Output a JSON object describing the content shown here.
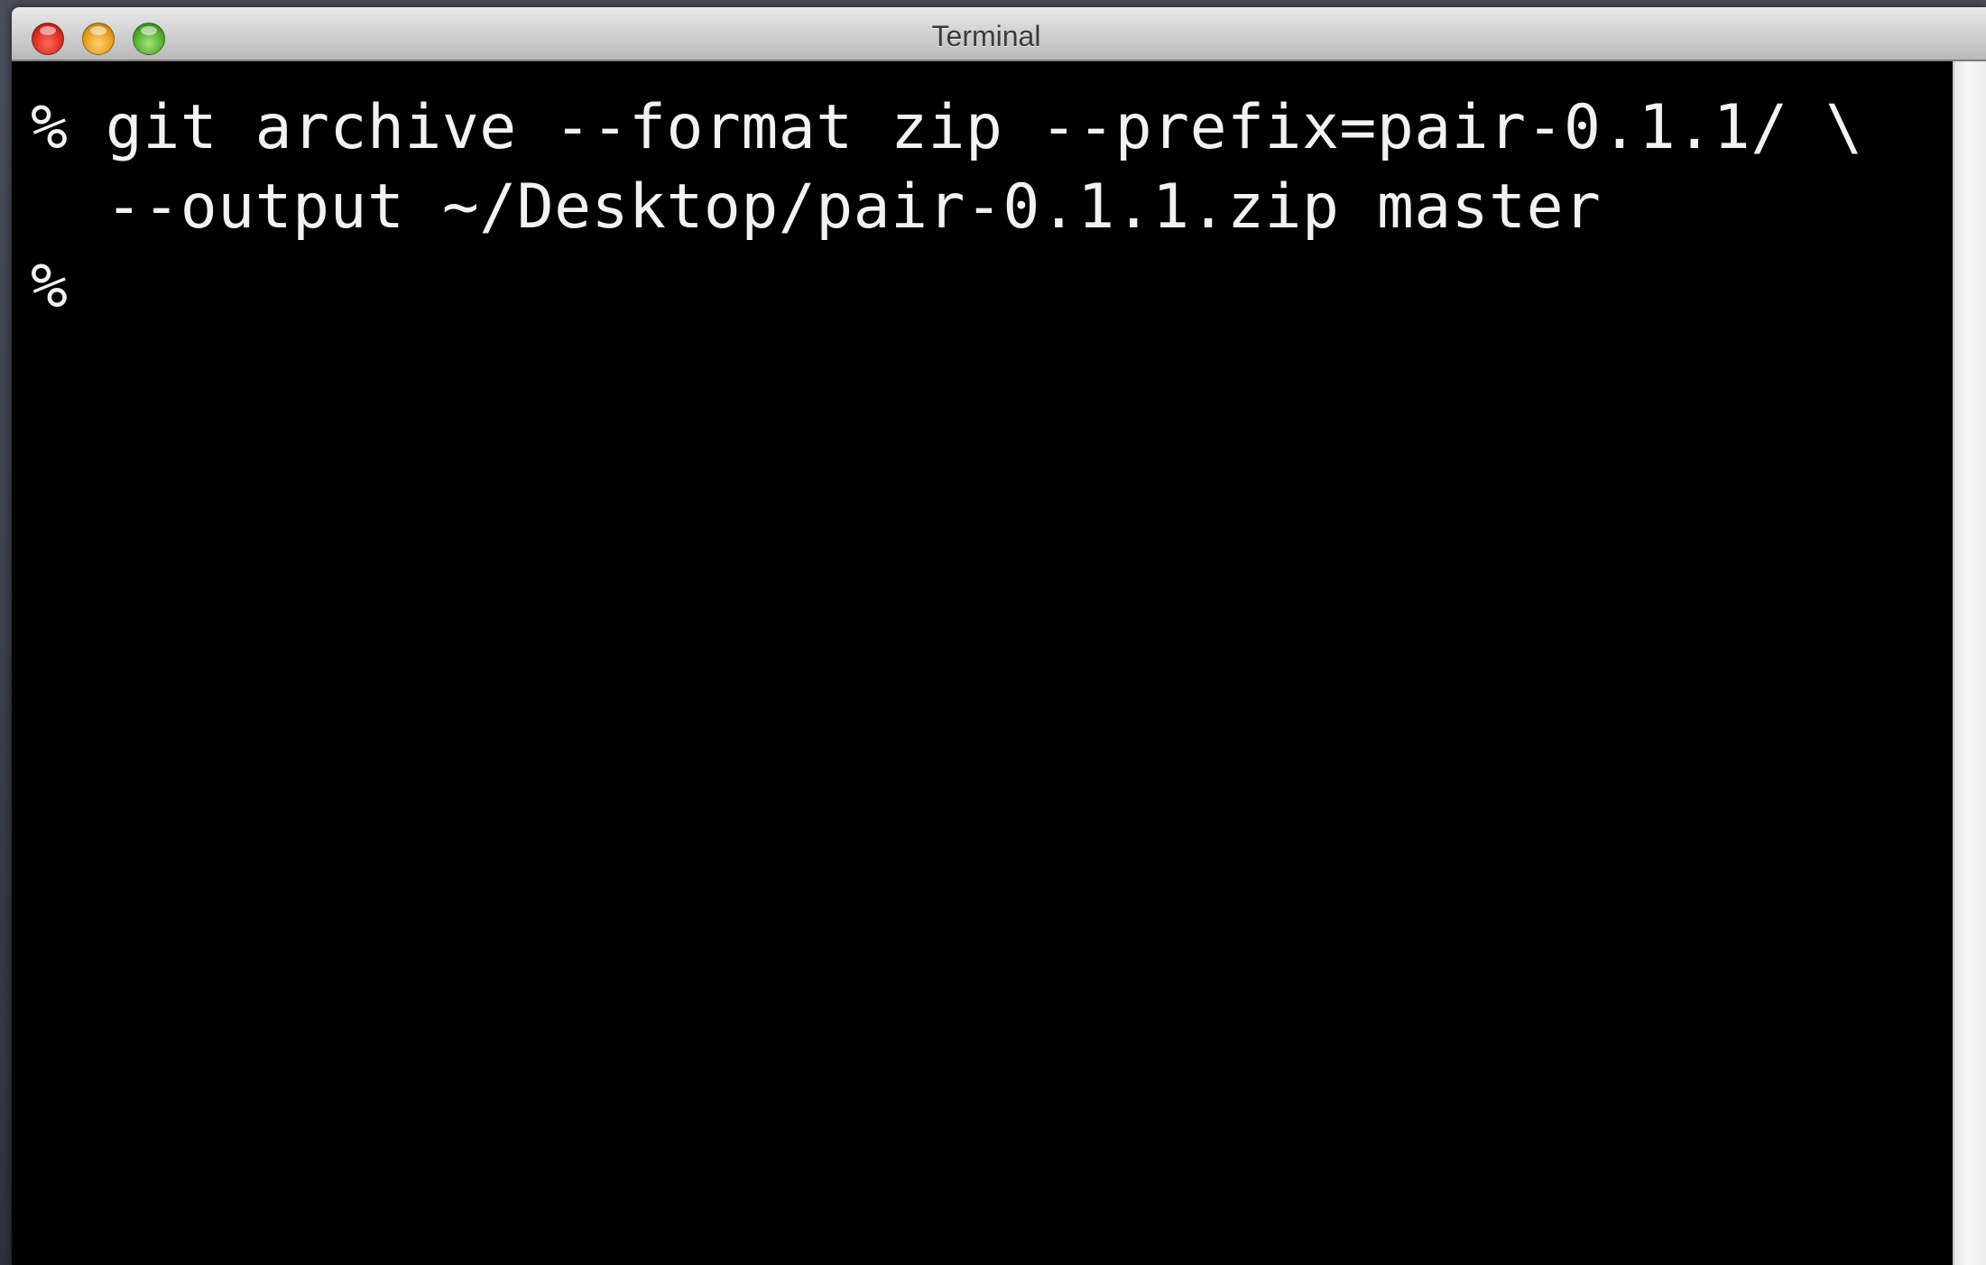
{
  "window": {
    "title": "Terminal",
    "buttons": {
      "close": "close-button",
      "minimize": "minimize-button",
      "zoom": "zoom-button"
    }
  },
  "terminal": {
    "lines": [
      "% git archive --format zip --prefix=pair-0.1.1/ \\",
      "  --output ~/Desktop/pair-0.1.1.zip master",
      "%"
    ]
  },
  "colors": {
    "background": "#000000",
    "foreground": "#f2f2f2",
    "titlebar": "#d0d0d0",
    "close": "#d8281c",
    "minimize": "#e39a17",
    "zoom": "#4ea82a"
  }
}
